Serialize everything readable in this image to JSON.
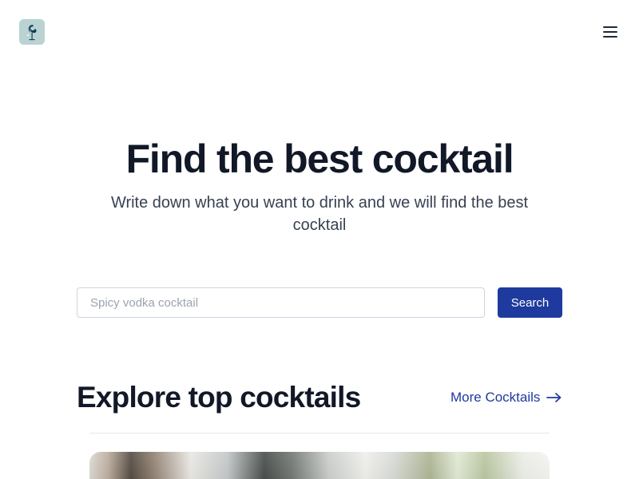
{
  "header": {
    "logo_icon": "cocktail-glass-logo-icon",
    "menu_icon": "hamburger-menu-icon"
  },
  "hero": {
    "title": "Find the best cocktail",
    "subtitle": "Write down what you want to drink and we will find the best cocktail"
  },
  "search": {
    "placeholder": "Spicy vodka cocktail",
    "value": "",
    "button_label": "Search"
  },
  "explore": {
    "title": "Explore top cocktails",
    "more_link_label": "More Cocktails",
    "more_link_icon": "arrow-right-icon"
  },
  "colors": {
    "accent": "#1e3a9e",
    "text_primary": "#111827",
    "text_secondary": "#374151",
    "logo_background": "#b9d3d3"
  }
}
